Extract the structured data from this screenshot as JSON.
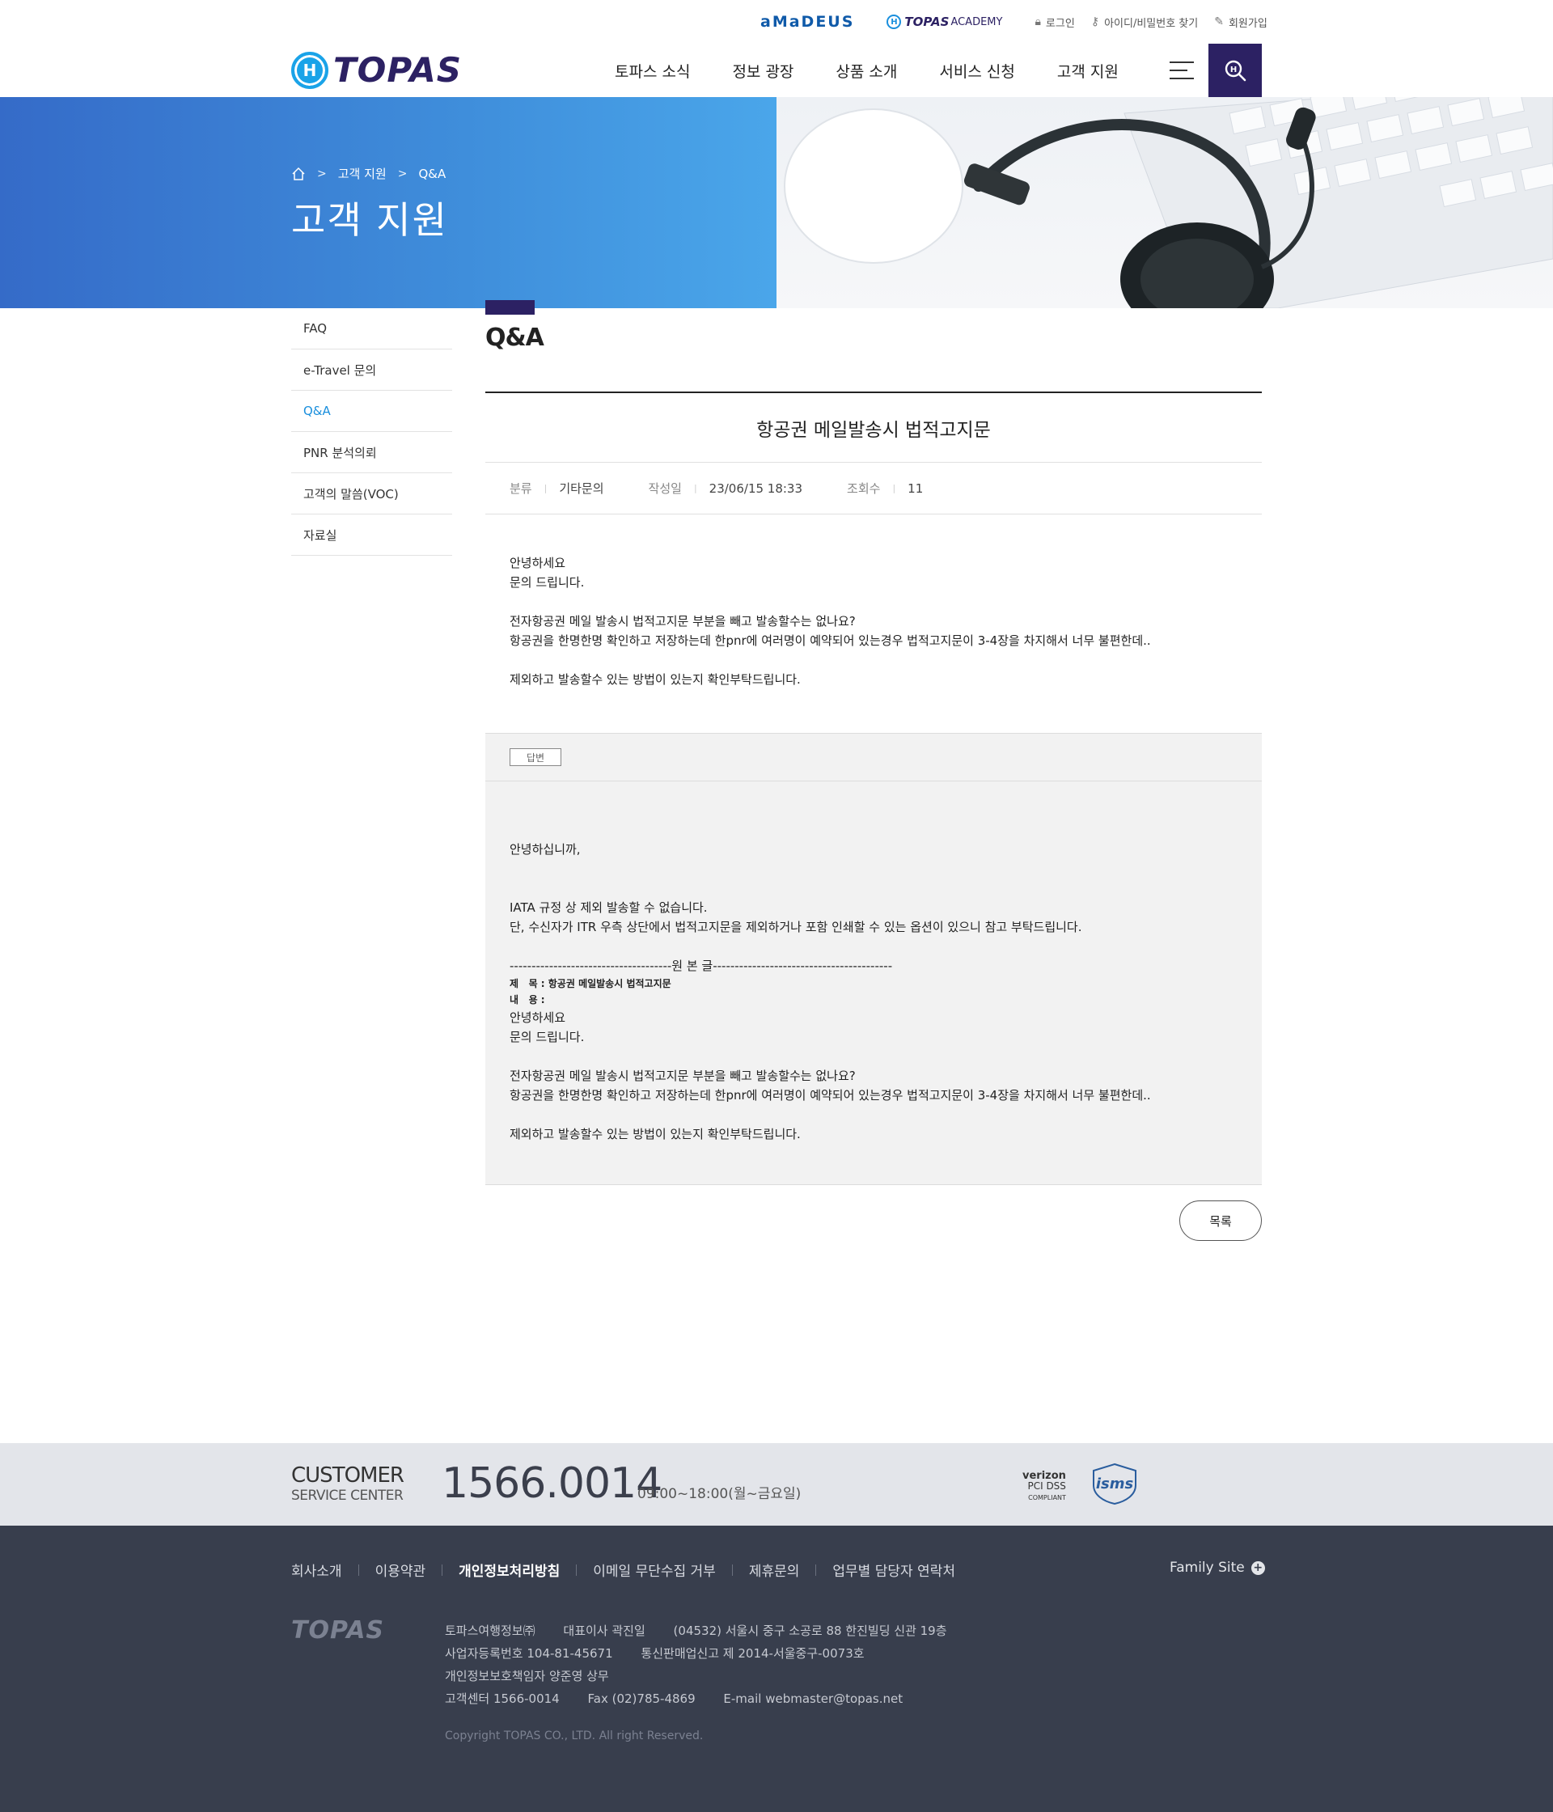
{
  "util": {
    "amadeus": "aMaDEUS",
    "academy_brand": "TOPAS",
    "academy_word": "ACADEMY",
    "login": "로그인",
    "find_id": "아이디/비밀번호 찾기",
    "join": "회원가입"
  },
  "logo": {
    "text": "TOPAS"
  },
  "gnb": [
    "토파스 소식",
    "정보 광장",
    "상품 소개",
    "서비스 신청",
    "고객 지원"
  ],
  "visual": {
    "breadcrumb": [
      "고객 지원",
      "Q&A"
    ],
    "title": "고객 지원"
  },
  "lnb": [
    {
      "label": "FAQ",
      "active": false
    },
    {
      "label": "e-Travel 문의",
      "active": false
    },
    {
      "label": "Q&A",
      "active": true
    },
    {
      "label": "PNR 분석의뢰",
      "active": false
    },
    {
      "label": "고객의 말씀(VOC)",
      "active": false
    },
    {
      "label": "자료실",
      "active": false
    }
  ],
  "content": {
    "title": "Q&A",
    "subject": "항공권 메일발송시 법적고지문",
    "meta": {
      "category_label": "분류",
      "category": "기타문의",
      "date_label": "작성일",
      "date": "23/06/15 18:33",
      "views_label": "조회수",
      "views": "11"
    },
    "body": [
      "안녕하세요",
      "문의 드립니다.",
      "",
      "전자항공권 메일 발송시 법적고지문 부분을 빼고 발송할수는 없나요?",
      "항공권을 한명한명 확인하고 저장하는데 한pnr에 여러명이 예약되어 있는경우 법적고지문이 3-4장을 차지해서 너무 불편한데..",
      "",
      "제외하고 발송할수 있는 방법이 있는지 확인부탁드립니다."
    ],
    "answer": {
      "tag": "답변",
      "greeting": "안녕하십니까,",
      "lines": [
        "IATA 규정 상 제외 발송할 수 없습니다.",
        "단, 수신자가 ITR 우측 상단에서 법적고지문을 제외하거나 포함 인쇄할 수 있는 옵션이 있으니 참고 부탁드립니다."
      ],
      "original_divider": "-------------------------------------원 본 글-----------------------------------------",
      "orig_subject": "제   목 : 항공권 메일발송시 법적고지문",
      "orig_content": "내   용 :",
      "orig_body": [
        "안녕하세요",
        "문의 드립니다.",
        "",
        "전자항공권 메일 발송시 법적고지문 부분을 빼고 발송할수는 없나요?",
        "항공권을 한명한명 확인하고 저장하는데 한pnr에 여러명이 예약되어 있는경우 법적고지문이 3-4장을 차지해서 너무 불편한데..",
        "",
        "제외하고 발송할수 있는 방법이 있는지 확인부탁드립니다."
      ]
    },
    "list_button": "목록"
  },
  "customer": {
    "title": "CUSTOMER",
    "subtitle": "SERVICE CENTER",
    "phone": "1566.0014",
    "hours": "09:00~18:00(월~금요일)",
    "verizon_line1": "verizon",
    "verizon_line2": "PCI DSS",
    "verizon_line3": "COMPLIANT",
    "isms": "isms"
  },
  "footer": {
    "nav": [
      {
        "label": "회사소개",
        "strong": false
      },
      {
        "label": "이용약관",
        "strong": false
      },
      {
        "label": "개인정보처리방침",
        "strong": true
      },
      {
        "label": "이메일 무단수집 거부",
        "strong": false
      },
      {
        "label": "제휴문의",
        "strong": false
      },
      {
        "label": "업무별 담당자 연락처",
        "strong": false
      }
    ],
    "family_site": "Family Site",
    "logo": "TOPAS",
    "info_rows": [
      [
        "토파스여행정보㈜",
        "대표이사 곽진일",
        "(04532) 서울시 중구 소공로 88 한진빌딩 신관 19층"
      ],
      [
        "사업자등록번호 104-81-45671",
        "통신판매업신고 제 2014-서울중구-0073호"
      ],
      [
        "개인정보보호책임자 양준영 상무"
      ],
      [
        "고객센터 1566-0014",
        "Fax (02)785-4869",
        "E-mail webmaster@topas.net"
      ]
    ],
    "copyright": "Copyright TOPAS CO., LTD. All right Reserved."
  },
  "colors": {
    "navy": "#2c2163",
    "accent_blue": "#1a8fdd",
    "banner_blue": "#3f8edb",
    "footer_bg": "#383e4d",
    "strip_bg": "#e3e5ea"
  }
}
